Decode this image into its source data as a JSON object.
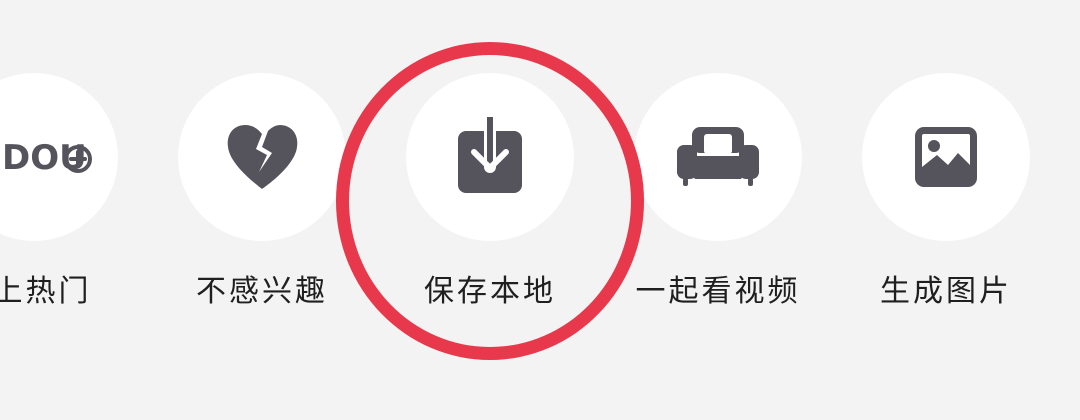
{
  "share_panel": {
    "actions": [
      {
        "id": "promote",
        "icon": "dou-plus-icon",
        "label": "上热门",
        "icon_text": "DOU"
      },
      {
        "id": "not-interested",
        "icon": "broken-heart-icon",
        "label": "不感兴趣"
      },
      {
        "id": "save-local",
        "icon": "download-icon",
        "label": "保存本地"
      },
      {
        "id": "watch-together",
        "icon": "sofa-icon",
        "label": "一起看视频"
      },
      {
        "id": "generate-image",
        "icon": "image-icon",
        "label": "生成图片"
      }
    ],
    "highlighted_action": "save-local"
  },
  "colors": {
    "background": "#f3f3f3",
    "button_bg": "#ffffff",
    "icon": "#55545c",
    "text": "#1f1f1f",
    "highlight": "#e8384c"
  }
}
